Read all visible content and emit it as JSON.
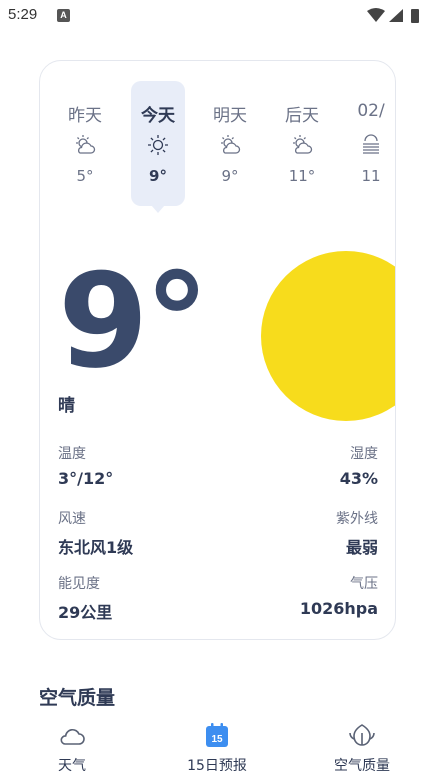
{
  "status_bar": {
    "time": "5:29",
    "notification_badge": "A"
  },
  "days": [
    {
      "label": "昨天",
      "temp": "5°",
      "icon": "partly-cloudy-icon",
      "active": false
    },
    {
      "label": "今天",
      "temp": "9°",
      "icon": "sun-icon",
      "active": true
    },
    {
      "label": "明天",
      "temp": "9°",
      "icon": "partly-cloudy-icon",
      "active": false
    },
    {
      "label": "后天",
      "temp": "11°",
      "icon": "partly-cloudy-icon",
      "active": false
    },
    {
      "label": "02/",
      "temp": "11",
      "icon": "fog-icon",
      "active": false
    }
  ],
  "current": {
    "temperature": "9°",
    "condition": "晴"
  },
  "metrics": {
    "temp_range": {
      "label": "温度",
      "value": "3°/12°"
    },
    "humidity": {
      "label": "湿度",
      "value": "43%"
    },
    "wind": {
      "label": "风速",
      "value": "东北风1级"
    },
    "uv": {
      "label": "紫外线",
      "value": "最弱"
    },
    "visibility": {
      "label": "能见度",
      "value": "29公里"
    },
    "pressure": {
      "label": "气压",
      "value": "1026hpa"
    }
  },
  "air_quality_title": "空气质量",
  "nav": {
    "weather": {
      "label": "天气",
      "icon": "cloud-icon"
    },
    "forecast": {
      "label": "15日预报",
      "icon": "calendar-icon",
      "badge": "15"
    },
    "air": {
      "label": "空气质量",
      "icon": "leaf-icon"
    }
  },
  "colors": {
    "accent_text": "#2f3a55",
    "sun": "#f7dc1c",
    "active_day_bg": "#e8edf8",
    "calendar_blue": "#3d8ef0"
  }
}
